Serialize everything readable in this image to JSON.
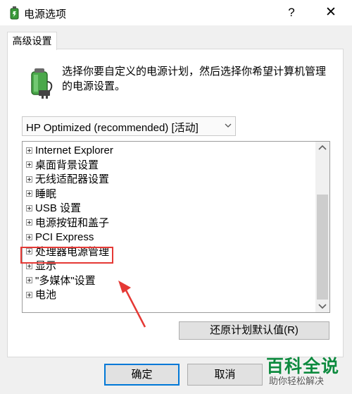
{
  "window": {
    "title": "电源选项",
    "help_label": "?",
    "close_label": "✕"
  },
  "tab": {
    "label": "高级设置"
  },
  "description": "选择你要自定义的电源计划，然后选择你希望计算机管理的电源设置。",
  "plan_select": {
    "value": "HP Optimized (recommended) [活动]"
  },
  "tree": {
    "items": [
      {
        "label": "Internet Explorer"
      },
      {
        "label": "桌面背景设置"
      },
      {
        "label": "无线适配器设置"
      },
      {
        "label": "睡眠"
      },
      {
        "label": "USB 设置"
      },
      {
        "label": "电源按钮和盖子"
      },
      {
        "label": "PCI Express"
      },
      {
        "label": "处理器电源管理"
      },
      {
        "label": "显示"
      },
      {
        "label": "\"多媒体\"设置"
      },
      {
        "label": "电池"
      }
    ]
  },
  "buttons": {
    "restore": "还原计划默认值(R)",
    "ok": "确定",
    "cancel": "取消"
  },
  "watermark": {
    "title": "百科全说",
    "subtitle": "助你轻松解决"
  },
  "colors": {
    "highlight": "#e53935",
    "accent": "#0078d7",
    "watermark": "#0e8a3f"
  }
}
